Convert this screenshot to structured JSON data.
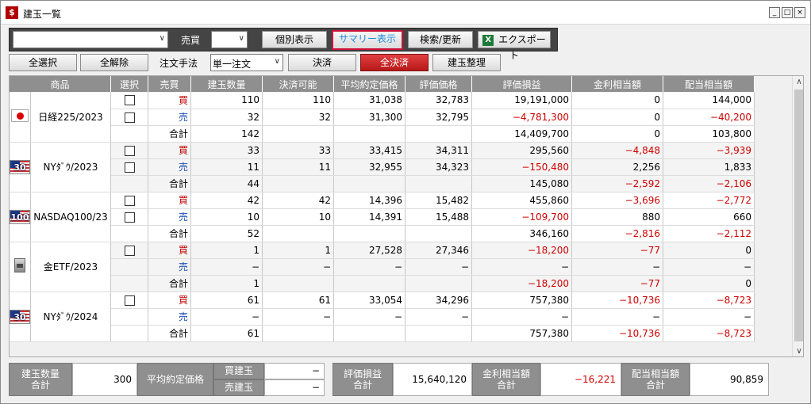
{
  "window": {
    "title": "建玉一覧",
    "app_icon": "$",
    "min": "_",
    "max": "□",
    "close": "×"
  },
  "toolbar": {
    "combo_value": "",
    "buysell_label": "売買",
    "buysell_value": "",
    "individual_label": "個別表示",
    "summary_label": "サマリー表示",
    "search_label": "検索/更新",
    "export_label": "エクスポート"
  },
  "actions": {
    "select_all": "全選択",
    "deselect_all": "全解除",
    "order_method_label": "注文手法",
    "order_method_value": "単一注文",
    "settle": "決済",
    "settle_all": "全決済",
    "organize": "建玉整理"
  },
  "columns": [
    "商品",
    "選択",
    "売買",
    "建玉数量",
    "決済可能",
    "平均約定価格",
    "評価価格",
    "評価損益",
    "金利相当額",
    "配当相当額"
  ],
  "groups": [
    {
      "name": "日経225/2023",
      "flag": "jp",
      "badge": "",
      "rows": [
        {
          "side": "買",
          "type": "buy",
          "chk": true,
          "qty": "110",
          "avail": "110",
          "avg": "31,038",
          "eval": "32,783",
          "pl": "19,191,000",
          "int": "0",
          "div": "144,000",
          "pl_neg": false,
          "int_neg": false,
          "div_neg": false
        },
        {
          "side": "売",
          "type": "sell",
          "chk": true,
          "qty": "32",
          "avail": "32",
          "avg": "31,300",
          "eval": "32,795",
          "pl": "−4,781,300",
          "int": "0",
          "div": "−40,200",
          "pl_neg": true,
          "int_neg": false,
          "div_neg": true
        },
        {
          "side": "合計",
          "type": "tot",
          "chk": false,
          "qty": "142",
          "avail": "",
          "avg": "",
          "eval": "",
          "pl": "14,409,700",
          "int": "0",
          "div": "103,800",
          "pl_neg": false,
          "int_neg": false,
          "div_neg": false
        }
      ]
    },
    {
      "name": "NYﾀﾞｳ/2023",
      "flag": "us",
      "badge": "30",
      "rows": [
        {
          "side": "買",
          "type": "buy",
          "chk": true,
          "qty": "33",
          "avail": "33",
          "avg": "33,415",
          "eval": "34,311",
          "pl": "295,560",
          "int": "−4,848",
          "div": "−3,939",
          "pl_neg": false,
          "int_neg": true,
          "div_neg": true
        },
        {
          "side": "売",
          "type": "sell",
          "chk": true,
          "qty": "11",
          "avail": "11",
          "avg": "32,955",
          "eval": "34,323",
          "pl": "−150,480",
          "int": "2,256",
          "div": "1,833",
          "pl_neg": true,
          "int_neg": false,
          "div_neg": false
        },
        {
          "side": "合計",
          "type": "tot",
          "chk": false,
          "qty": "44",
          "avail": "",
          "avg": "",
          "eval": "",
          "pl": "145,080",
          "int": "−2,592",
          "div": "−2,106",
          "pl_neg": false,
          "int_neg": true,
          "div_neg": true
        }
      ]
    },
    {
      "name": "NASDAQ100/23",
      "flag": "us",
      "badge": "100",
      "rows": [
        {
          "side": "買",
          "type": "buy",
          "chk": true,
          "qty": "42",
          "avail": "42",
          "avg": "14,396",
          "eval": "15,482",
          "pl": "455,860",
          "int": "−3,696",
          "div": "−2,772",
          "pl_neg": false,
          "int_neg": true,
          "div_neg": true
        },
        {
          "side": "売",
          "type": "sell",
          "chk": true,
          "qty": "10",
          "avail": "10",
          "avg": "14,391",
          "eval": "15,488",
          "pl": "−109,700",
          "int": "880",
          "div": "660",
          "pl_neg": true,
          "int_neg": false,
          "div_neg": false
        },
        {
          "side": "合計",
          "type": "tot",
          "chk": false,
          "qty": "52",
          "avail": "",
          "avg": "",
          "eval": "",
          "pl": "346,160",
          "int": "−2,816",
          "div": "−2,112",
          "pl_neg": false,
          "int_neg": true,
          "div_neg": true
        }
      ]
    },
    {
      "name": "金ETF/2023",
      "flag": "gold",
      "badge": "",
      "rows": [
        {
          "side": "買",
          "type": "buy",
          "chk": true,
          "qty": "1",
          "avail": "1",
          "avg": "27,528",
          "eval": "27,346",
          "pl": "−18,200",
          "int": "−77",
          "div": "0",
          "pl_neg": true,
          "int_neg": true,
          "div_neg": false
        },
        {
          "side": "売",
          "type": "sell",
          "chk": false,
          "qty": "−",
          "avail": "−",
          "avg": "−",
          "eval": "−",
          "pl": "−",
          "int": "−",
          "div": "−",
          "pl_neg": false,
          "int_neg": false,
          "div_neg": false
        },
        {
          "side": "合計",
          "type": "tot",
          "chk": false,
          "qty": "1",
          "avail": "",
          "avg": "",
          "eval": "",
          "pl": "−18,200",
          "int": "−77",
          "div": "0",
          "pl_neg": true,
          "int_neg": true,
          "div_neg": false
        }
      ]
    },
    {
      "name": "NYﾀﾞｳ/2024",
      "flag": "us",
      "badge": "30",
      "rows": [
        {
          "side": "買",
          "type": "buy",
          "chk": true,
          "qty": "61",
          "avail": "61",
          "avg": "33,054",
          "eval": "34,296",
          "pl": "757,380",
          "int": "−10,736",
          "div": "−8,723",
          "pl_neg": false,
          "int_neg": true,
          "div_neg": true
        },
        {
          "side": "売",
          "type": "sell",
          "chk": false,
          "qty": "−",
          "avail": "−",
          "avg": "−",
          "eval": "−",
          "pl": "−",
          "int": "−",
          "div": "−",
          "pl_neg": false,
          "int_neg": false,
          "div_neg": false
        },
        {
          "side": "合計",
          "type": "tot",
          "chk": false,
          "qty": "61",
          "avail": "",
          "avg": "",
          "eval": "",
          "pl": "757,380",
          "int": "−10,736",
          "div": "−8,723",
          "pl_neg": false,
          "int_neg": true,
          "div_neg": true
        }
      ]
    }
  ],
  "summary": {
    "qty_label": "建玉数量\n合計",
    "qty_value": "300",
    "avg_label": "平均約定価格",
    "buy_label": "買建玉",
    "buy_value": "−",
    "sell_label": "売建玉",
    "sell_value": "−",
    "pl_label": "評価損益\n合計",
    "pl_value": "15,640,120",
    "int_label": "金利相当額\n合計",
    "int_value": "−16,221",
    "div_label": "配当相当額\n合計",
    "div_value": "90,859"
  },
  "colors": {
    "accent_red": "#d00000",
    "sell_blue": "#1e50b4",
    "header_gray": "#8f8f8f",
    "selected_border": "#d0103a"
  }
}
